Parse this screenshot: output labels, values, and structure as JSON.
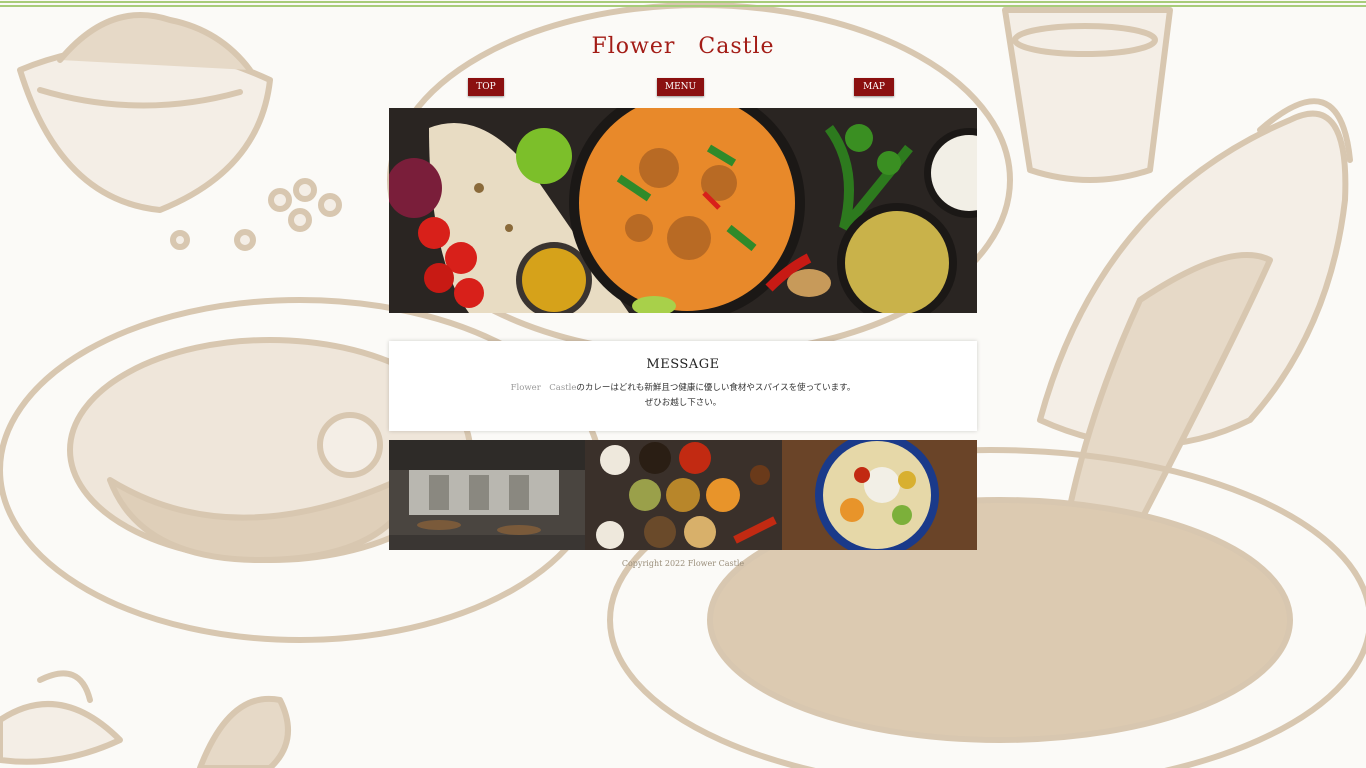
{
  "site": {
    "title": "Flower　Castle"
  },
  "nav": {
    "top": "TOP",
    "menu": "MENU",
    "map": "MAP"
  },
  "message": {
    "heading": "MESSAGE",
    "line1_name": "Flower　Castle",
    "line1_rest": "のカレーはどれも新鮮且つ健康に優しい食材やスパイスを使っています。",
    "line2": "ぜひお越し下さい。"
  },
  "footer": {
    "copyright": "Copyright 2022 Flower Castle"
  },
  "colors": {
    "accent": "#a31c16",
    "nav_button": "#8b1010",
    "top_line": "#a8cc7a",
    "sketch": "#d8c7b0"
  }
}
